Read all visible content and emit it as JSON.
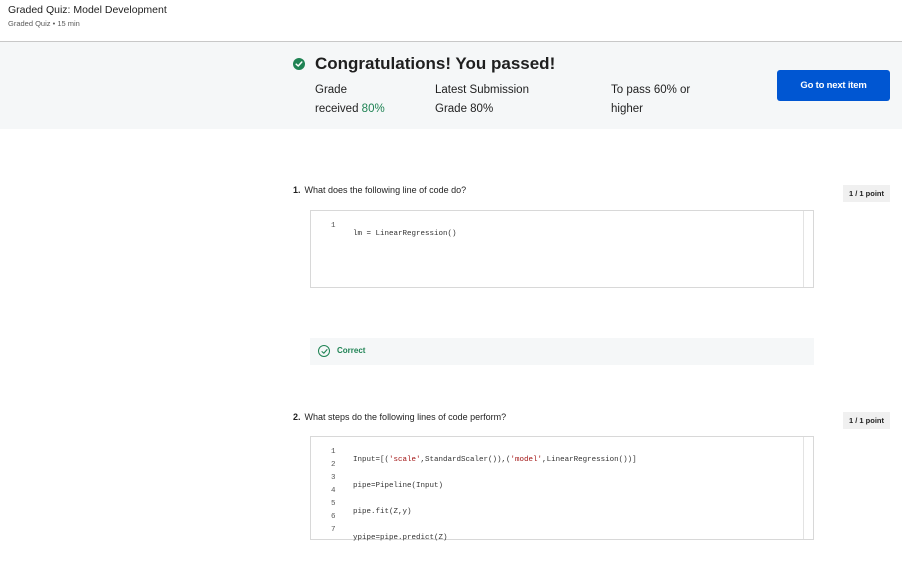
{
  "header": {
    "title": "Graded Quiz: Model Development",
    "subtitle": "Graded Quiz • 15 min"
  },
  "banner": {
    "icon": "check-circle-icon",
    "heading": "Congratulations! You passed!",
    "grade_label_1": "Grade",
    "grade_label_2": "received",
    "grade_value": "80%",
    "latest_label_1": "Latest Submission",
    "latest_label_2": "Grade 80%",
    "pass_label_1": "To pass 60% or",
    "pass_label_2": "higher",
    "next_button": "Go to next item",
    "accent_color": "#0056d2",
    "success_color": "#1f8354"
  },
  "questions": [
    {
      "number": "1.",
      "prompt": "What does the following line of code do?",
      "points": "1 / 1 point",
      "code": [
        {
          "ln": "1",
          "text": "lm = LinearRegression()"
        }
      ],
      "feedback": "Correct"
    },
    {
      "number": "2.",
      "prompt": "What steps do the following lines of code perform?",
      "points": "1 / 1 point",
      "code": [
        {
          "ln": "1",
          "pre": "Input=[(",
          "s1": "'scale'",
          "mid": ",StandardScaler()),(",
          "s2": "'model'",
          "post": ",LinearRegression())]"
        },
        {
          "ln": "2",
          "text": ""
        },
        {
          "ln": "3",
          "text": "pipe=Pipeline(Input)"
        },
        {
          "ln": "4",
          "text": ""
        },
        {
          "ln": "5",
          "text": "pipe.fit(Z,y)"
        },
        {
          "ln": "6",
          "text": ""
        },
        {
          "ln": "7",
          "text": "ypipe=pipe.predict(Z)"
        }
      ]
    }
  ]
}
